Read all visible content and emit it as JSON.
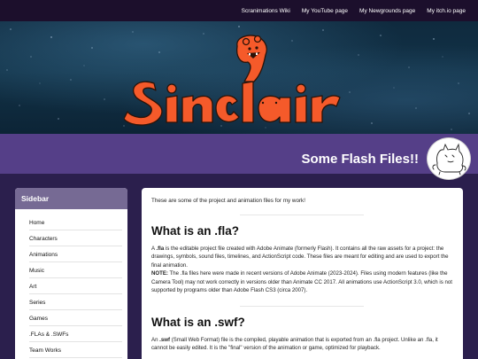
{
  "topnav": {
    "links": [
      "Scranimations Wiki",
      "My YouTube page",
      "My Newgrounds page",
      "My itch.io page"
    ]
  },
  "banner": {
    "logo_text": "Sinclair"
  },
  "header": {
    "title": "Some Flash Files!!"
  },
  "sidebar": {
    "heading": "Sidebar",
    "items": [
      "Home",
      "Characters",
      "Animations",
      "Music",
      "Art",
      "Series",
      "Games",
      ".FLAs & .SWFs",
      "Team Works"
    ]
  },
  "main": {
    "intro": "These are some of the project and animation files for my work!",
    "fla": {
      "heading": "What is an .fla?",
      "p1_pre": "A ",
      "p1_bold": ".fla",
      "p1_post": " is the editable project file created with Adobe Animate (formerly Flash). It contains all the raw assets for a project: the drawings, symbols, sound files, timelines, and ActionScript code. These files are meant for editing and are used to export the final animation.",
      "note_label": "NOTE:",
      "note_text": " The .fla files here were made in recent versions of Adobe Animate (2023-2024). Files using modern features (like the Camera Tool) may not work correctly in versions older than Animate CC 2017. All animations use ActionScript 3.0, which is not supported by programs older than Adobe Flash CS3 (circa 2007)."
    },
    "swf": {
      "heading": "What is an .swf?",
      "p1_pre": "An ",
      "p1_bold": ".swf",
      "p1_post": " (Small Web Format) file is the compiled, playable animation that is exported from an .fla project. Unlike an .fla, it cannot be easily edited. It is the \"final\" version of the animation or game, optimized for playback."
    }
  },
  "colors": {
    "topnav_bg": "#1c0f2c",
    "titlebar_bg": "#553f88",
    "sidebar_head_bg": "#766a94",
    "logo_orange": "#f55a2a"
  }
}
